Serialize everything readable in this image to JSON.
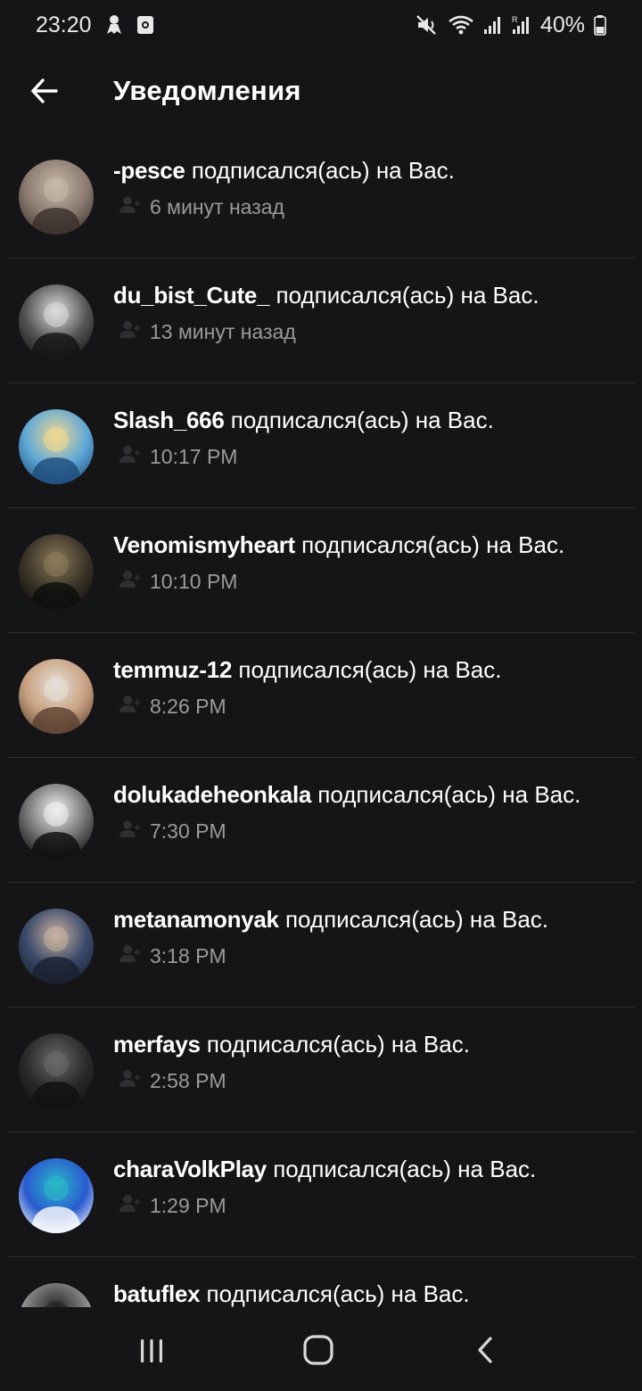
{
  "status_bar": {
    "time": "23:20",
    "battery": "40%",
    "icons": [
      "ghost-icon",
      "screen-record-icon",
      "mute-icon",
      "wifi-icon",
      "signal-icon",
      "signal-roaming-icon",
      "battery-icon"
    ]
  },
  "header": {
    "title": "Уведомления",
    "back_icon": "arrow-left-icon"
  },
  "notifications": [
    {
      "username": "-pesce",
      "action": "подписался(ась) на Вас.",
      "time": "6 минут назад",
      "avatar_colors": [
        "#3a2e2a",
        "#8a7a70",
        "#c9b8a8"
      ]
    },
    {
      "username": "du_bist_Cute_",
      "action": "подписался(ась) на Вас.",
      "time": "13 минут назад",
      "avatar_colors": [
        "#111111",
        "#555555",
        "#dddddd"
      ]
    },
    {
      "username": "Slash_666",
      "action": "подписался(ась) на Вас.",
      "time": "10:17 PM",
      "avatar_colors": [
        "#1e4c7a",
        "#5fa8d8",
        "#f0d890"
      ]
    },
    {
      "username": "Venomismyheart",
      "action": "подписался(ась) на Вас.",
      "time": "10:10 PM",
      "avatar_colors": [
        "#0d0d0d",
        "#3a3328",
        "#8c7a5a"
      ]
    },
    {
      "username": "temmuz-12",
      "action": "подписался(ась) на Вас.",
      "time": "8:26 PM",
      "avatar_colors": [
        "#5a4030",
        "#c8a080",
        "#e6e0d8"
      ]
    },
    {
      "username": "dolukadeheonkala",
      "action": "подписался(ась) на Вас.",
      "time": "7:30 PM",
      "avatar_colors": [
        "#0a0a0a",
        "#707070",
        "#f0f0f0"
      ]
    },
    {
      "username": "metanamonyak",
      "action": "подписался(ась) на Вас.",
      "time": "3:18 PM",
      "avatar_colors": [
        "#1a1f2e",
        "#3a4a6a",
        "#c8b0a0"
      ]
    },
    {
      "username": "merfays",
      "action": "подписался(ась) на Вас.",
      "time": "2:58 PM",
      "avatar_colors": [
        "#101010",
        "#2a2a2a",
        "#6a6a6a"
      ]
    },
    {
      "username": "charaVolkPlay",
      "action": "подписался(ась) на Вас.",
      "time": "1:29 PM",
      "avatar_colors": [
        "#ffffff",
        "#2a5ad0",
        "#2ab8c8"
      ]
    },
    {
      "username": "batuflex",
      "action": "подписался(ась) на Вас.",
      "time": "",
      "avatar_colors": [
        "#f0f0f0",
        "#888888",
        "#222222"
      ]
    }
  ],
  "nav": {
    "recents_icon": "recent-apps-icon",
    "home_icon": "home-icon",
    "back_icon": "back-chevron-icon"
  }
}
